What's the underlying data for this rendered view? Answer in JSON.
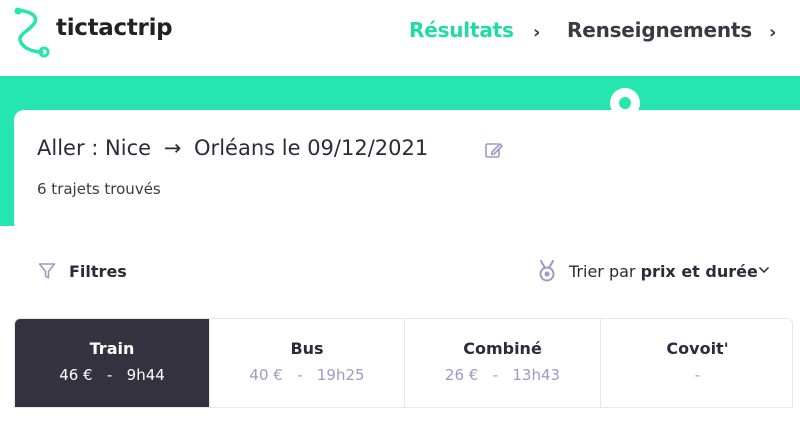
{
  "header": {
    "brand": "tictactrip",
    "steps": [
      {
        "label": "Résultats",
        "active": true
      },
      {
        "label": "Renseignements",
        "active": false
      }
    ],
    "accent_color": "#1fdca4"
  },
  "trip": {
    "prefix": "Aller :",
    "origin": "Nice",
    "arrow": "→",
    "destination": "Orléans",
    "date": "le 09/12/2021",
    "results_count": "6 trajets trouvés"
  },
  "toolbar": {
    "filters_label": "Filtres",
    "sort_prefix": "Trier par",
    "sort_value": "prix et durée"
  },
  "tabs": [
    {
      "name": "Train",
      "price": "46 €",
      "sep": "-",
      "duration": "9h44",
      "active": true
    },
    {
      "name": "Bus",
      "price": "40 €",
      "sep": "-",
      "duration": "19h25",
      "active": false
    },
    {
      "name": "Combiné",
      "price": "26 €",
      "sep": "-",
      "duration": "13h43",
      "active": false
    },
    {
      "name": "Covoit'",
      "price": "-",
      "sep": "",
      "duration": "",
      "active": false
    }
  ],
  "icons": [
    "logo-icon",
    "chevron-right-icon",
    "edit-icon",
    "filter-icon",
    "medal-icon",
    "chevron-down-icon"
  ]
}
